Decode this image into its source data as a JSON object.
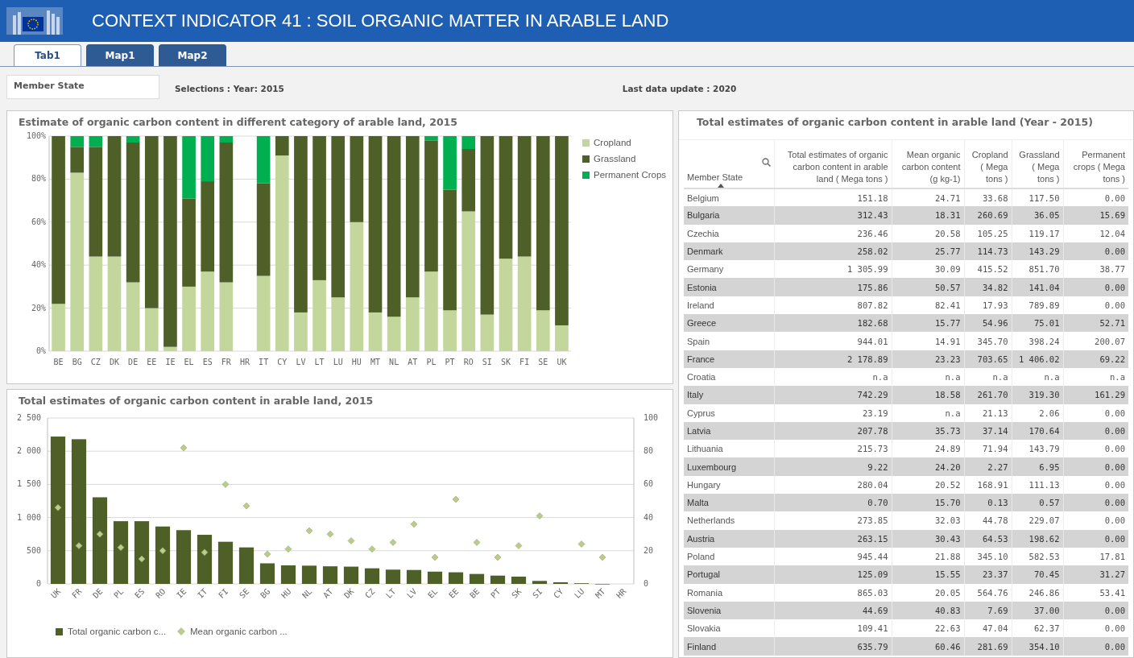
{
  "header": {
    "title": "CONTEXT INDICATOR 41 : SOIL ORGANIC MATTER IN ARABLE LAND"
  },
  "tabs": [
    {
      "label": "Tab1",
      "selected": true
    },
    {
      "label": "Map1",
      "selected": false
    },
    {
      "label": "Map2",
      "selected": false
    }
  ],
  "filter": {
    "label": "Member State"
  },
  "selections": "Selections : Year: 2015",
  "last_update": "Last data update : 2020",
  "charts": [
    {
      "title": "Estimate of organic carbon content in different category of arable land, 2015",
      "chart_data": {
        "type": "bar",
        "stacked": true,
        "grid": true,
        "legend": true,
        "categories": [
          "BE",
          "BG",
          "CZ",
          "DK",
          "DE",
          "EE",
          "IE",
          "EL",
          "ES",
          "FR",
          "HR",
          "IT",
          "CY",
          "LV",
          "LT",
          "LU",
          "HU",
          "MT",
          "NL",
          "AT",
          "PL",
          "PT",
          "RO",
          "SI",
          "SK",
          "FI",
          "SE",
          "UK"
        ],
        "ylim": [
          0,
          1
        ],
        "yticks": [
          {
            "value": 0,
            "label": "0%"
          },
          {
            "value": 0.2,
            "label": "20%"
          },
          {
            "value": 0.4,
            "label": "40%"
          },
          {
            "value": 0.6,
            "label": "60%"
          },
          {
            "value": 0.8,
            "label": "80%"
          },
          {
            "value": 1,
            "label": "100%"
          }
        ],
        "series": [
          {
            "name": "Cropland",
            "color": "#c3d69b",
            "values": [
              0.22,
              0.83,
              0.44,
              0.44,
              0.32,
              0.2,
              0.02,
              0.3,
              0.37,
              0.32,
              null,
              0.35,
              0.91,
              0.18,
              0.33,
              0.25,
              0.6,
              0.18,
              0.16,
              0.25,
              0.37,
              0.19,
              0.65,
              0.17,
              0.43,
              0.44,
              0.19,
              0.12
            ]
          },
          {
            "name": "Grassland",
            "color": "#4e5f27",
            "values": [
              0.78,
              0.12,
              0.51,
              0.56,
              0.65,
              0.8,
              0.98,
              0.41,
              0.42,
              0.65,
              null,
              0.43,
              0.09,
              0.82,
              0.67,
              0.75,
              0.4,
              0.82,
              0.84,
              0.75,
              0.61,
              0.56,
              0.29,
              0.83,
              0.57,
              0.56,
              0.81,
              0.88
            ]
          },
          {
            "name": "Permanent Crops",
            "color": "#00b050",
            "values": [
              0,
              0.05,
              0.05,
              0,
              0.03,
              0,
              0,
              0.29,
              0.21,
              0.03,
              null,
              0.22,
              0,
              0,
              0,
              0,
              0,
              0,
              0,
              0,
              0.02,
              0.25,
              0.06,
              0,
              0,
              0,
              0,
              0
            ]
          }
        ]
      }
    },
    {
      "title": "Total estimates of organic carbon content in arable land, 2015",
      "chart_data": {
        "type": "bar",
        "grid": true,
        "legend": true,
        "categories": [
          "UK",
          "FR",
          "DE",
          "PL",
          "ES",
          "RO",
          "IE",
          "IT",
          "FI",
          "SE",
          "BG",
          "HU",
          "NL",
          "AT",
          "DK",
          "CZ",
          "LT",
          "LV",
          "EL",
          "EE",
          "BE",
          "PT",
          "SK",
          "SI",
          "CY",
          "LU",
          "MT",
          "HR"
        ],
        "ylim": [
          0,
          2500
        ],
        "yticks": [
          {
            "value": 0,
            "label": "0"
          },
          {
            "value": 500,
            "label": "500"
          },
          {
            "value": 1000,
            "label": "1 000"
          },
          {
            "value": 1500,
            "label": "1 500"
          },
          {
            "value": 2000,
            "label": "2 000"
          },
          {
            "value": 2500,
            "label": "2 500"
          }
        ],
        "y2lim": [
          0,
          100
        ],
        "y2ticks": [
          0,
          20,
          40,
          60,
          80,
          100
        ],
        "series": [
          {
            "name": "Total organic carbon c...",
            "type": "bar",
            "color": "#4e5f27",
            "values": [
              2220,
              2180,
              1305,
              945,
              945,
              865,
              810,
              740,
              635,
              550,
              310,
              280,
              275,
              265,
              260,
              235,
              215,
              210,
              185,
              175,
              150,
              125,
              110,
              45,
              25,
              10,
              0,
              null
            ]
          },
          {
            "name": "Mean organic carbon ...",
            "type": "scatter",
            "axis": "y2",
            "color": "#b8cc8c",
            "values": [
              46,
              23,
              30,
              22,
              15,
              20,
              82,
              19,
              60,
              47,
              18,
              21,
              32,
              30,
              26,
              21,
              25,
              36,
              16,
              51,
              25,
              16,
              23,
              41,
              null,
              24,
              16,
              null
            ]
          }
        ]
      }
    }
  ],
  "table": {
    "title": "Total estimates of organic carbon content in arable land (Year - 2015)",
    "columns": [
      "Member State",
      "Total estimates of organic carbon content in arable land ( Mega tons )",
      "Mean organic carbon content (g kg-1)",
      "Cropland ( Mega tons )",
      "Grassland ( Mega tons )",
      "Permanent crops ( Mega tons )"
    ],
    "rows": [
      [
        "Belgium",
        "151.18",
        "24.71",
        "33.68",
        "117.50",
        "0.00"
      ],
      [
        "Bulgaria",
        "312.43",
        "18.31",
        "260.69",
        "36.05",
        "15.69"
      ],
      [
        "Czechia",
        "236.46",
        "20.58",
        "105.25",
        "119.17",
        "12.04"
      ],
      [
        "Denmark",
        "258.02",
        "25.77",
        "114.73",
        "143.29",
        "0.00"
      ],
      [
        "Germany",
        "1 305.99",
        "30.09",
        "415.52",
        "851.70",
        "38.77"
      ],
      [
        "Estonia",
        "175.86",
        "50.57",
        "34.82",
        "141.04",
        "0.00"
      ],
      [
        "Ireland",
        "807.82",
        "82.41",
        "17.93",
        "789.89",
        "0.00"
      ],
      [
        "Greece",
        "182.68",
        "15.77",
        "54.96",
        "75.01",
        "52.71"
      ],
      [
        "Spain",
        "944.01",
        "14.91",
        "345.70",
        "398.24",
        "200.07"
      ],
      [
        "France",
        "2 178.89",
        "23.23",
        "703.65",
        "1 406.02",
        "69.22"
      ],
      [
        "Croatia",
        "n.a",
        "n.a",
        "n.a",
        "n.a",
        "n.a"
      ],
      [
        "Italy",
        "742.29",
        "18.58",
        "261.70",
        "319.30",
        "161.29"
      ],
      [
        "Cyprus",
        "23.19",
        "n.a",
        "21.13",
        "2.06",
        "0.00"
      ],
      [
        "Latvia",
        "207.78",
        "35.73",
        "37.14",
        "170.64",
        "0.00"
      ],
      [
        "Lithuania",
        "215.73",
        "24.89",
        "71.94",
        "143.79",
        "0.00"
      ],
      [
        "Luxembourg",
        "9.22",
        "24.20",
        "2.27",
        "6.95",
        "0.00"
      ],
      [
        "Hungary",
        "280.04",
        "20.52",
        "168.91",
        "111.13",
        "0.00"
      ],
      [
        "Malta",
        "0.70",
        "15.70",
        "0.13",
        "0.57",
        "0.00"
      ],
      [
        "Netherlands",
        "273.85",
        "32.03",
        "44.78",
        "229.07",
        "0.00"
      ],
      [
        "Austria",
        "263.15",
        "30.43",
        "64.53",
        "198.62",
        "0.00"
      ],
      [
        "Poland",
        "945.44",
        "21.88",
        "345.10",
        "582.53",
        "17.81"
      ],
      [
        "Portugal",
        "125.09",
        "15.55",
        "23.37",
        "70.45",
        "31.27"
      ],
      [
        "Romania",
        "865.03",
        "20.05",
        "564.76",
        "246.86",
        "53.41"
      ],
      [
        "Slovenia",
        "44.69",
        "40.83",
        "7.69",
        "37.00",
        "0.00"
      ],
      [
        "Slovakia",
        "109.41",
        "22.63",
        "47.04",
        "62.37",
        "0.00"
      ],
      [
        "Finland",
        "635.79",
        "60.46",
        "281.69",
        "354.10",
        "0.00"
      ]
    ]
  }
}
